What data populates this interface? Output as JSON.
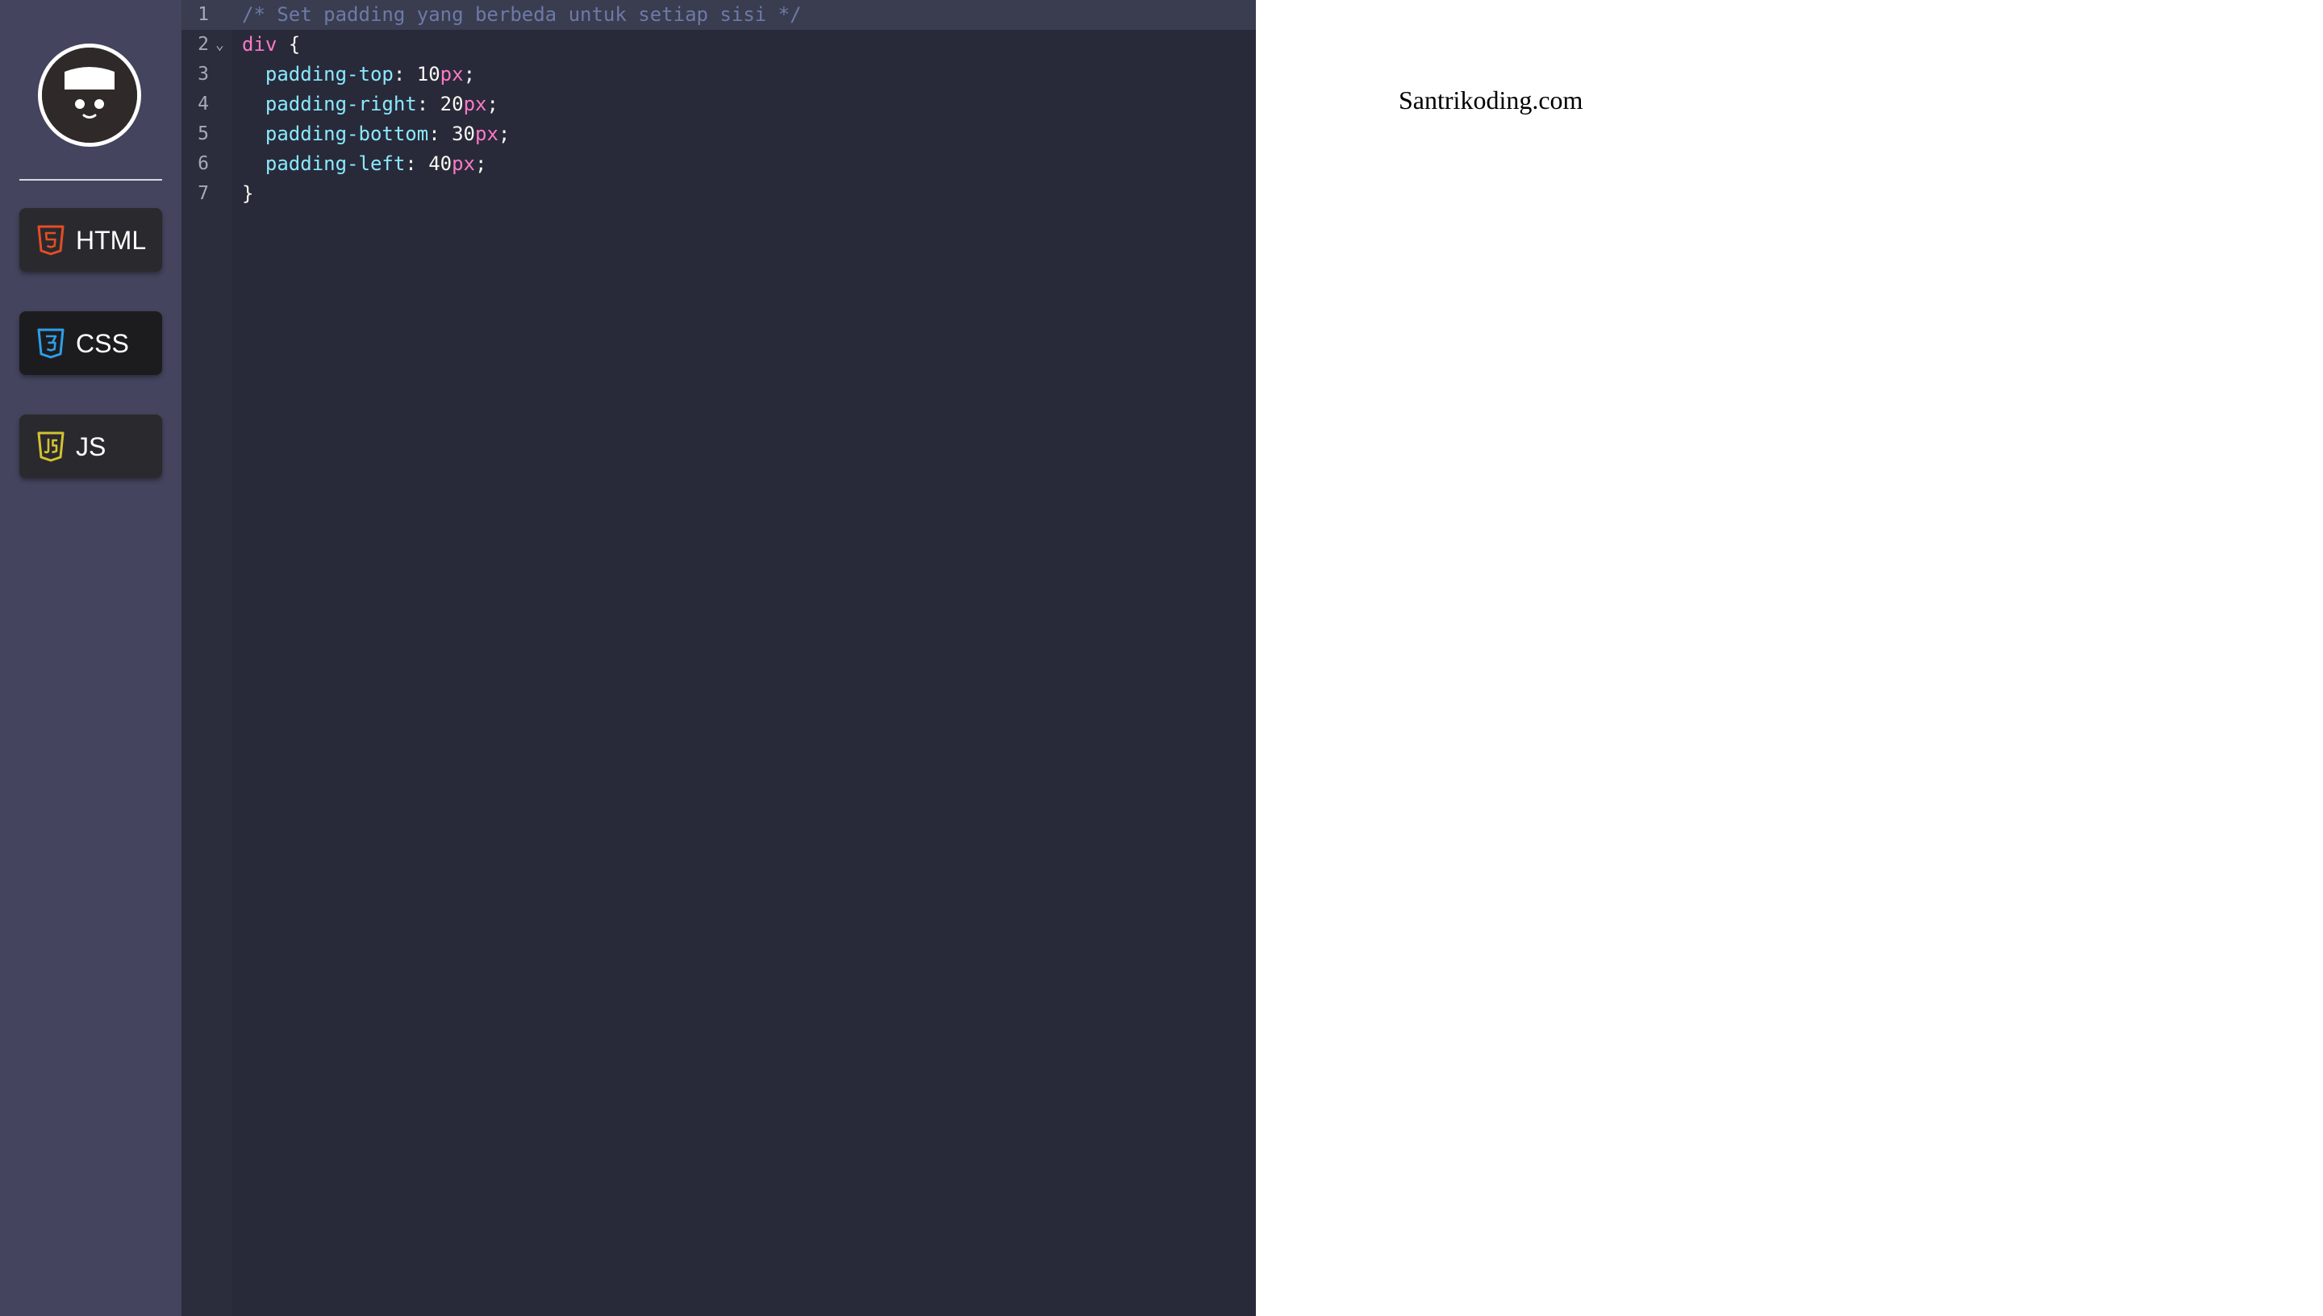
{
  "sidebar": {
    "buttons": [
      {
        "label": "HTML",
        "icon": "html5-icon",
        "color": "#e44d26"
      },
      {
        "label": "CSS",
        "icon": "css3-icon",
        "color": "#2f9ee8"
      },
      {
        "label": "JS",
        "icon": "js-icon",
        "color": "#d4c232"
      }
    ],
    "active": "CSS"
  },
  "editor": {
    "lines": [
      {
        "number": "1",
        "code": "/* Set padding yang berbeda untuk setiap sisi */"
      },
      {
        "number": "2",
        "code": "div {",
        "foldable": true
      },
      {
        "number": "3",
        "code": "  padding-top: 10px;"
      },
      {
        "number": "4",
        "code": "  padding-right: 20px;"
      },
      {
        "number": "5",
        "code": "  padding-bottom: 30px;"
      },
      {
        "number": "6",
        "code": "  padding-left: 40px;"
      },
      {
        "number": "7",
        "code": "}"
      }
    ],
    "active_line": "1"
  },
  "preview": {
    "text": "Santrikoding.com"
  }
}
